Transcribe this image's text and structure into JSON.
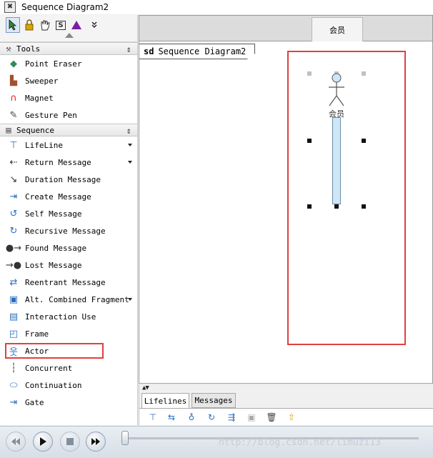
{
  "window": {
    "title": "Sequence Diagram2",
    "app_icon": "app-icon"
  },
  "palette": {
    "toolbar": [
      {
        "name": "select-pointer-icon",
        "glyph": "➚"
      },
      {
        "name": "lock-icon",
        "glyph": "🔒"
      },
      {
        "name": "hand-pan-icon",
        "glyph": "✋"
      },
      {
        "name": "s-icon",
        "glyph": "S"
      },
      {
        "name": "purple-triangle-icon",
        "glyph": "▲"
      },
      {
        "name": "double-chevron-icon",
        "glyph": "⌄"
      }
    ],
    "groups": [
      {
        "label": "Tools",
        "items": [
          {
            "label": "Point Eraser",
            "icon": "eraser-icon",
            "glyph": "◆",
            "color": "#2e8b57"
          },
          {
            "label": "Sweeper",
            "icon": "sweeper-icon",
            "glyph": "▙",
            "color": "#a0522d"
          },
          {
            "label": "Magnet",
            "icon": "magnet-icon",
            "glyph": "∩",
            "color": "#d22"
          },
          {
            "label": "Gesture Pen",
            "icon": "gesture-pen-icon",
            "glyph": "✎",
            "color": "#444"
          }
        ]
      },
      {
        "label": "Sequence",
        "items": [
          {
            "label": "LifeLine",
            "icon": "lifeline-icon",
            "glyph": "⊤",
            "color": "#2a6fbf",
            "dropdown": true
          },
          {
            "label": "Return Message",
            "icon": "return-message-icon",
            "glyph": "⇠",
            "color": "#333",
            "dropdown": true
          },
          {
            "label": "Duration Message",
            "icon": "duration-message-icon",
            "glyph": "↘",
            "color": "#333"
          },
          {
            "label": "Create Message",
            "icon": "create-message-icon",
            "glyph": "⇥",
            "color": "#2a6fbf"
          },
          {
            "label": "Self Message",
            "icon": "self-message-icon",
            "glyph": "↺",
            "color": "#2a6fbf"
          },
          {
            "label": "Recursive Message",
            "icon": "recursive-message-icon",
            "glyph": "↻",
            "color": "#2a6fbf"
          },
          {
            "label": "Found Message",
            "icon": "found-message-icon",
            "glyph": "●→",
            "color": "#333"
          },
          {
            "label": "Lost Message",
            "icon": "lost-message-icon",
            "glyph": "→●",
            "color": "#333"
          },
          {
            "label": "Reentrant Message",
            "icon": "reentrant-message-icon",
            "glyph": "⇄",
            "color": "#2a6fbf"
          },
          {
            "label": "Alt. Combined Fragment",
            "icon": "combined-fragment-icon",
            "glyph": "▣",
            "color": "#2a6fbf",
            "dropdown": true
          },
          {
            "label": "Interaction Use",
            "icon": "interaction-use-icon",
            "glyph": "▤",
            "color": "#2a6fbf"
          },
          {
            "label": "Frame",
            "icon": "frame-icon",
            "glyph": "◰",
            "color": "#2a6fbf"
          },
          {
            "label": "Actor",
            "icon": "actor-icon",
            "glyph": "웃",
            "color": "#2a6fbf"
          },
          {
            "label": "Concurrent",
            "icon": "concurrent-icon",
            "glyph": "┆",
            "color": "#333"
          },
          {
            "label": "Continuation",
            "icon": "continuation-icon",
            "glyph": "⬭",
            "color": "#2a6fbf"
          },
          {
            "label": "Gate",
            "icon": "gate-icon",
            "glyph": "⇥",
            "color": "#2a6fbf"
          }
        ]
      }
    ]
  },
  "canvas": {
    "lane_tab": "会员",
    "frame_keyword": "sd",
    "frame_name": "Sequence Diagram2",
    "actor_name": "会员"
  },
  "bottom_tabs": [
    "Lifelines",
    "Messages"
  ],
  "tab_toolbar_icons": [
    "add-lifeline-icon",
    "add-message-icon",
    "lifeline-pin-icon",
    "refresh-icon",
    "link-icon",
    "save-icon",
    "trash-icon",
    "up-arrow-icon"
  ],
  "player": {
    "buttons": [
      "rewind-icon",
      "play-icon",
      "stop-icon",
      "fast-forward-icon"
    ],
    "watermark": "http://blog.csdn.net/limuzi13"
  },
  "colors": {
    "highlight": "#e04040",
    "activation": "#cfe6f7"
  }
}
